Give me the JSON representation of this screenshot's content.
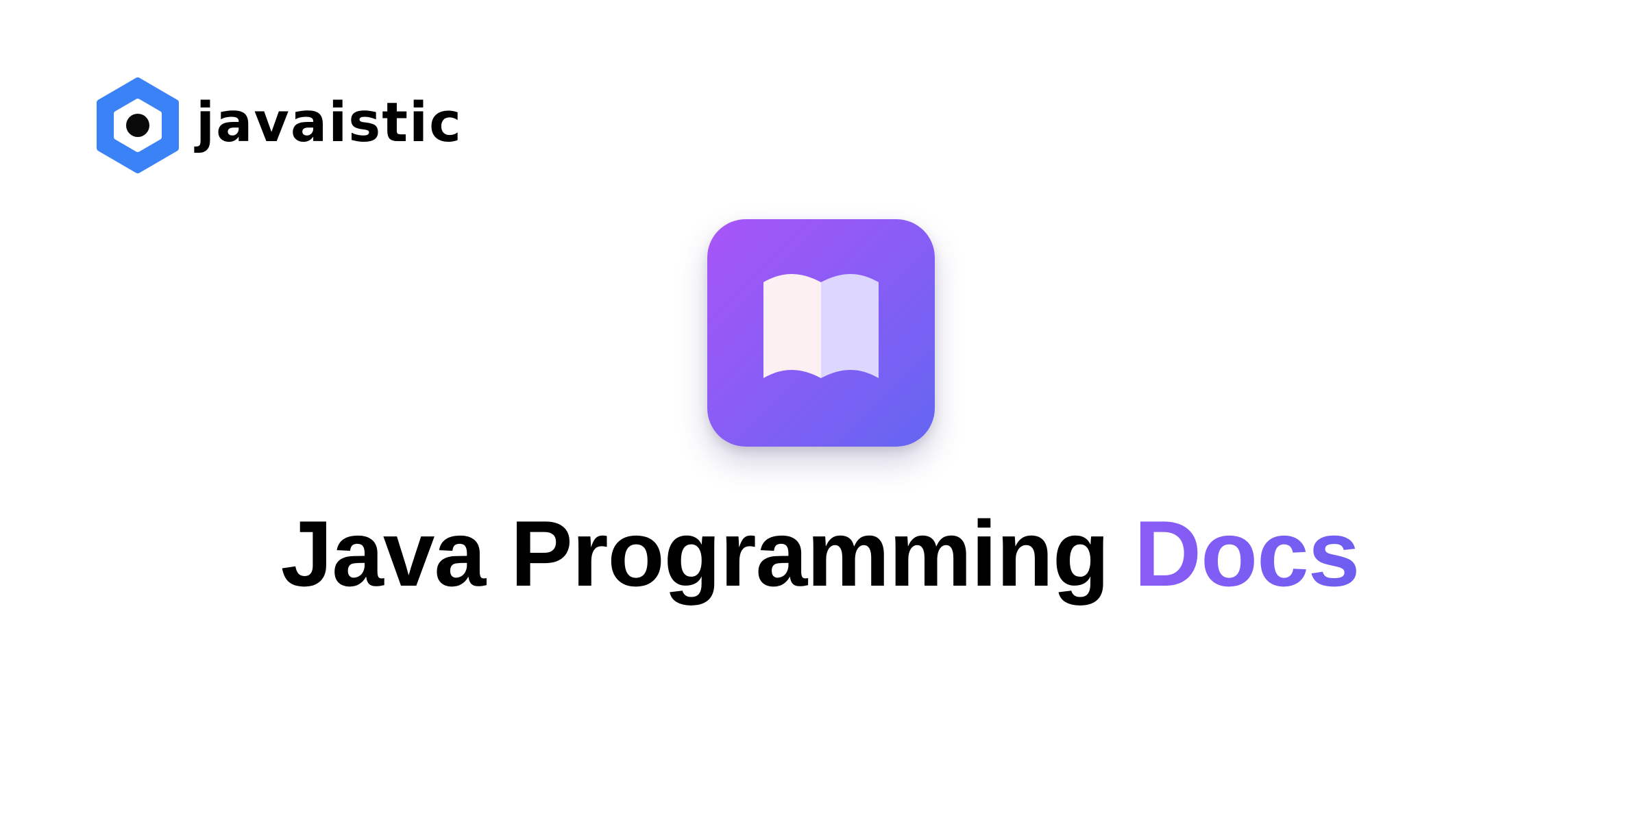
{
  "brand": {
    "name": "javaistic",
    "logo_icon": "hexagon-logo-icon",
    "logo_color": "#3b82f6"
  },
  "app_icon": {
    "icon": "open-book-icon",
    "gradient_start": "#a855f7",
    "gradient_end": "#6366f1"
  },
  "headline": {
    "primary": "Java Programming",
    "accent": "Docs",
    "accent_color": "#7c5cf0"
  }
}
